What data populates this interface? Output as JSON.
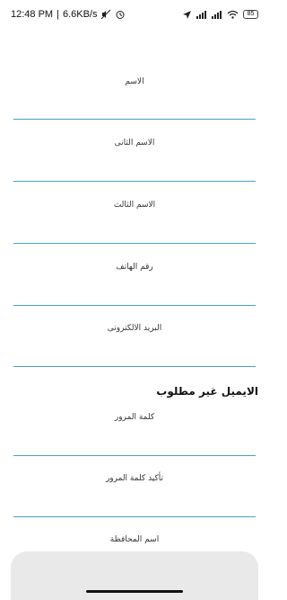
{
  "status_bar": {
    "time": "12:48 PM",
    "speed": "6.6KB/s",
    "battery": "85",
    "icons": [
      "muted-icon",
      "alarm-icon",
      "location-icon",
      "signal-icon",
      "signal-icon",
      "wifi-icon",
      "battery-icon"
    ]
  },
  "form": {
    "fields": [
      {
        "label": "الاسم"
      },
      {
        "label": "الاسم الثانى"
      },
      {
        "label": "الاسم الثالث"
      },
      {
        "label": "رقم الهاتف"
      },
      {
        "label": "البريد الالكترونى"
      },
      {
        "label": "كلمة المرور"
      },
      {
        "label": "تأكيد كلمة المرور"
      },
      {
        "label": "اسم المحافظة"
      }
    ],
    "email_note": "الايميل غير مطلوب"
  },
  "colors": {
    "underline": "#4f9ec6",
    "bottom_button": "#e9e9e9"
  }
}
